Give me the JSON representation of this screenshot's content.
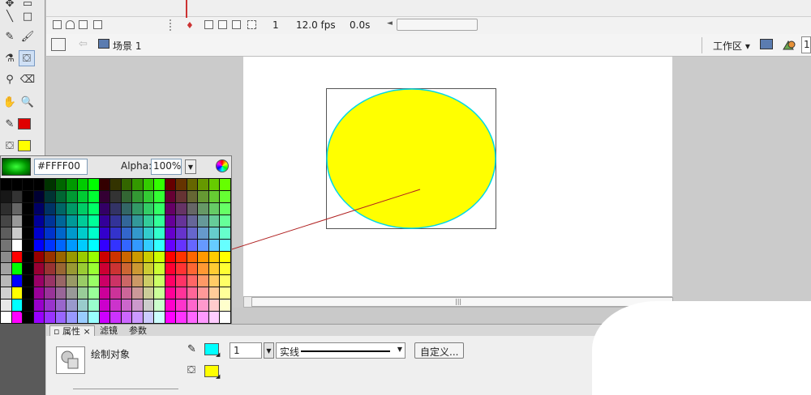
{
  "timeline": {
    "frame": "1",
    "fps": "12.0 fps",
    "time": "0.0s"
  },
  "editbar": {
    "scene": "场景 1",
    "workspace": "工作区",
    "zoom_partial": "1"
  },
  "color_popup": {
    "hex": "#FFFF00",
    "alpha_label": "Alpha:",
    "alpha_value": "100%"
  },
  "props": {
    "tabs": [
      "属性",
      "滤镜",
      "参数"
    ],
    "tab_close": "×",
    "object_label": "绘制对象",
    "stroke_height": "1",
    "stroke_style": "实线",
    "custom_button": "自定义..."
  },
  "colors": {
    "fill": "#FFFF00",
    "stroke": "#00FFFF",
    "tool_stroke": "#E00000",
    "selected_preview": "#00AA00"
  }
}
